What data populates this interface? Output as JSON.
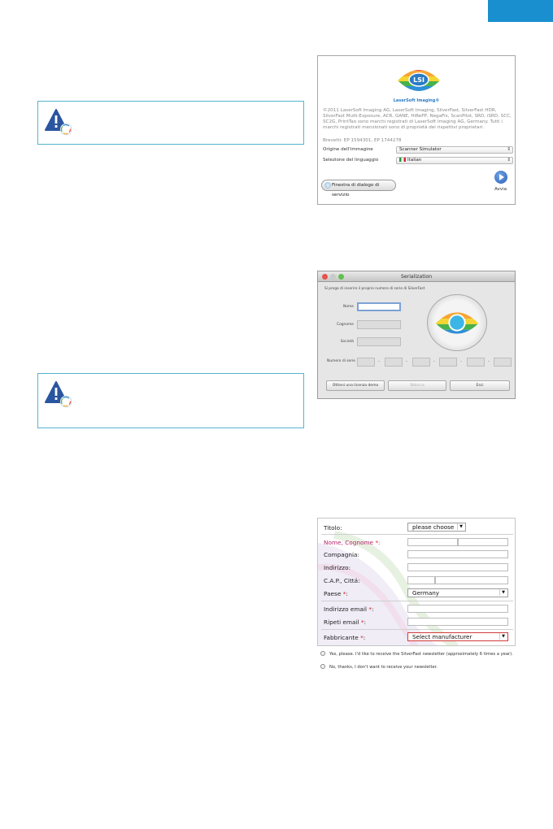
{
  "colors": {
    "accent": "#1a8fd0",
    "box_border": "#55b3cf",
    "error": "#d42020"
  },
  "panel1": {
    "logo_text": "LSI",
    "logo_caption": "LaserSoft Imaging®",
    "copyright": "©2011 LaserSoft Imaging AG, LaserSoft Imaging, SilverFast, SilverFast HDR, SilverFast Multi-Exposure, ACR, GANE, HiRePP, NegaFix, ScanPilot, SRD, iSRD, SCC, SC2G, PrintTao sono marchi registrati di LaserSoft Imaging AG, Germany. Tutti i marchi registrati menzionati sono di proprietà dei rispettivi proprietari.",
    "patents": "Brevetti: EP 1594301, EP 1744278",
    "source_label": "Origine dell'immagine",
    "source_value": "Scanner Simulator",
    "language_label": "Selezione del linguaggio",
    "language_value": "Italian",
    "service_button": "Finestra di dialogo di servizio",
    "start_label": "Avvia"
  },
  "panel2": {
    "window_title": "Serialization",
    "instruction": "Si prega di inserire il proprio numero di serie di SilverFast",
    "name_label": "Nome",
    "surname_label": "Cognome",
    "company_label": "Società",
    "serial_label": "Numero di serie",
    "demo_button": "Ottieni una licenza demo",
    "unlock_button": "Sblocca",
    "exit_button": "Esci"
  },
  "panel3": {
    "title_label": "Titolo:",
    "title_value": "please choose",
    "name_label": "Nome, Cognome",
    "name_suffix": ":",
    "company_label": "Compagnia:",
    "address_label": "Indirizzo:",
    "zip_label": "C.A.P., Cittá:",
    "country_label": "Paese",
    "country_value": "Germany",
    "email_label": "Indirizzo email",
    "email_repeat_label": "Ripeti email",
    "manufacturer_label": "Fabbricante",
    "manufacturer_value": "Select manufacturer",
    "required_mark": "*",
    "colon": ":",
    "newsletter_yes": "Yes, please. I'd like to receive the SilverFast newsletter (approximately 6 times a year).",
    "newsletter_no": "No, thanks, I don't want to receive your newsletter."
  }
}
